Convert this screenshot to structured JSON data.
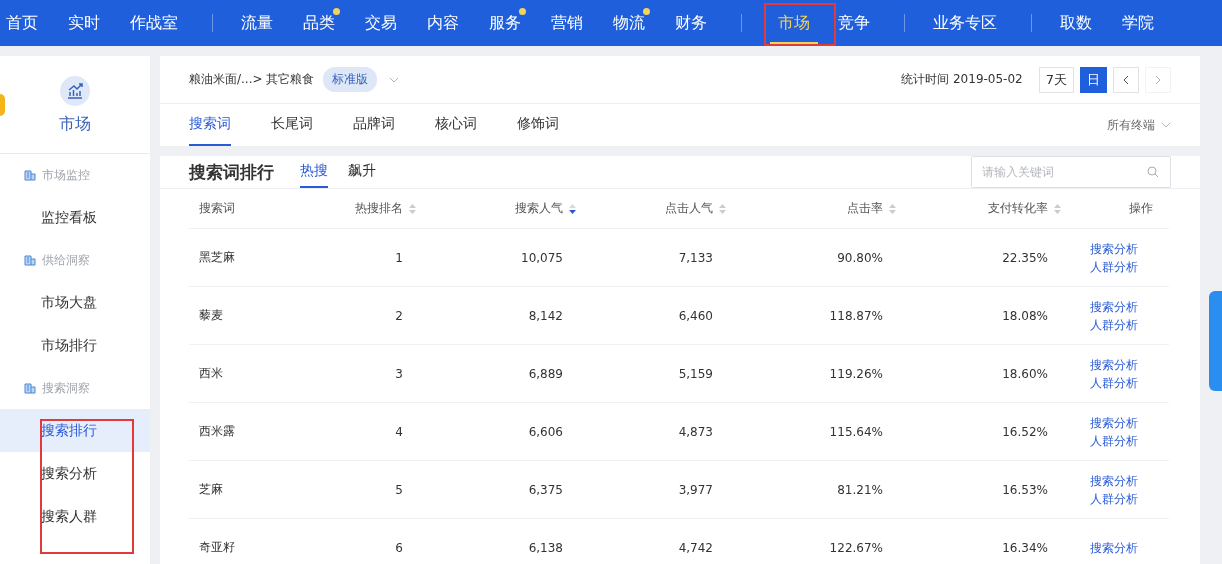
{
  "top_nav": {
    "groups": [
      [
        {
          "label": "首页",
          "selected": false,
          "dot": false
        },
        {
          "label": "实时",
          "selected": false,
          "dot": false
        },
        {
          "label": "作战室",
          "selected": false,
          "dot": false
        }
      ],
      [
        {
          "label": "流量",
          "selected": false,
          "dot": false
        },
        {
          "label": "品类",
          "selected": false,
          "dot": true
        },
        {
          "label": "交易",
          "selected": false,
          "dot": false
        },
        {
          "label": "内容",
          "selected": false,
          "dot": false
        },
        {
          "label": "服务",
          "selected": false,
          "dot": true
        },
        {
          "label": "营销",
          "selected": false,
          "dot": false
        },
        {
          "label": "物流",
          "selected": false,
          "dot": true
        },
        {
          "label": "财务",
          "selected": false,
          "dot": false
        }
      ],
      [
        {
          "label": "市场",
          "selected": true,
          "dot": false
        },
        {
          "label": "竞争",
          "selected": false,
          "dot": false
        }
      ],
      [
        {
          "label": "业务专区",
          "selected": false,
          "dot": false
        }
      ],
      [
        {
          "label": "取数",
          "selected": false,
          "dot": false
        },
        {
          "label": "学院",
          "selected": false,
          "dot": false
        }
      ]
    ]
  },
  "sidebar": {
    "title": "市场",
    "sections": [
      {
        "title": "市场监控",
        "items": [
          {
            "label": "监控看板",
            "selected": false
          }
        ]
      },
      {
        "title": "供给洞察",
        "items": [
          {
            "label": "市场大盘",
            "selected": false
          },
          {
            "label": "市场排行",
            "selected": false
          }
        ]
      },
      {
        "title": "搜索洞察",
        "items": [
          {
            "label": "搜索排行",
            "selected": true
          },
          {
            "label": "搜索分析",
            "selected": false
          },
          {
            "label": "搜索人群",
            "selected": false
          }
        ]
      }
    ]
  },
  "filter_bar": {
    "breadcrumb": "粮油米面/...> 其它粮食",
    "edition": "标准版",
    "stat_time": "统计时间 2019-05-02",
    "periods": [
      {
        "label": "7天",
        "selected": false
      },
      {
        "label": "日",
        "selected": true
      }
    ],
    "prev_disabled": false,
    "next_disabled": true,
    "tabs": [
      {
        "label": "搜索词",
        "selected": true
      },
      {
        "label": "长尾词",
        "selected": false
      },
      {
        "label": "品牌词",
        "selected": false
      },
      {
        "label": "核心词",
        "selected": false
      },
      {
        "label": "修饰词",
        "selected": false
      }
    ],
    "terminal": "所有终端"
  },
  "ranking": {
    "title": "搜索词排行",
    "tabs": [
      {
        "label": "热搜",
        "selected": true
      },
      {
        "label": "飙升",
        "selected": false
      }
    ],
    "search": {
      "placeholder": "请输入关键词"
    },
    "table": {
      "columns": [
        {
          "label": "搜索词",
          "sortable": false,
          "kind": "text"
        },
        {
          "label": "热搜排名",
          "sortable": true,
          "sorted_desc": false,
          "kind": "number"
        },
        {
          "label": "搜索人气",
          "sortable": true,
          "sorted_desc": true,
          "kind": "number"
        },
        {
          "label": "点击人气",
          "sortable": true,
          "sorted_desc": false,
          "kind": "number"
        },
        {
          "label": "点击率",
          "sortable": true,
          "sorted_desc": false,
          "kind": "number"
        },
        {
          "label": "支付转化率",
          "sortable": true,
          "sorted_desc": false,
          "kind": "number"
        },
        {
          "label": "操作",
          "sortable": false,
          "kind": "actions"
        }
      ],
      "rows": [
        {
          "cells": [
            "黑芝麻",
            "1",
            "10,075",
            "7,133",
            "90.80%",
            "22.35%"
          ],
          "actions": [
            "搜索分析",
            "人群分析"
          ]
        },
        {
          "cells": [
            "藜麦",
            "2",
            "8,142",
            "6,460",
            "118.87%",
            "18.08%"
          ],
          "actions": [
            "搜索分析",
            "人群分析"
          ]
        },
        {
          "cells": [
            "西米",
            "3",
            "6,889",
            "5,159",
            "119.26%",
            "18.60%"
          ],
          "actions": [
            "搜索分析",
            "人群分析"
          ]
        },
        {
          "cells": [
            "西米露",
            "4",
            "6,606",
            "4,873",
            "115.64%",
            "16.52%"
          ],
          "actions": [
            "搜索分析",
            "人群分析"
          ]
        },
        {
          "cells": [
            "芝麻",
            "5",
            "6,375",
            "3,977",
            "81.21%",
            "16.53%"
          ],
          "actions": [
            "搜索分析",
            "人群分析"
          ]
        },
        {
          "cells": [
            "奇亚籽",
            "6",
            "6,138",
            "4,742",
            "122.67%",
            "16.34%"
          ],
          "actions": [
            "搜索分析"
          ]
        }
      ]
    }
  }
}
